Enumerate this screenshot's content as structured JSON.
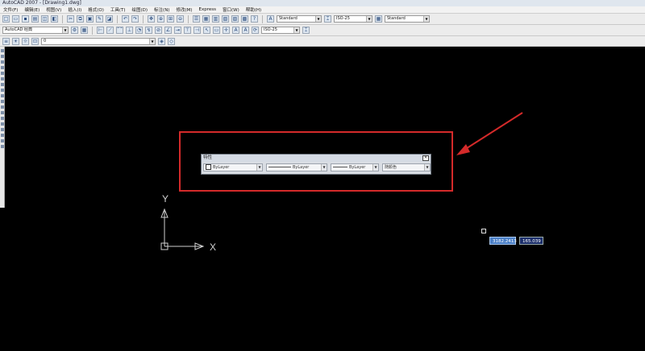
{
  "window": {
    "title": "AutoCAD 2007 - [Drawing1.dwg]"
  },
  "menubar": {
    "items": [
      "文件(F)",
      "编辑(E)",
      "视图(V)",
      "插入(I)",
      "格式(O)",
      "工具(T)",
      "绘图(D)",
      "标注(N)",
      "修改(M)",
      "Express",
      "窗口(W)",
      "帮助(H)"
    ]
  },
  "toolbar1": {
    "text_style": "Standard",
    "dim_style": "ISO-25",
    "table_style": "Standard"
  },
  "toolbar2": {
    "workspace": "AutoCAD 经典",
    "dim_style": "ISO-25"
  },
  "toolbar3": {
    "layer": "0"
  },
  "properties_panel": {
    "title": "特性",
    "close": "✕",
    "color": "ByLayer",
    "linetype": "ByLayer",
    "lineweight": "ByLayer",
    "plot_style": "随颜色"
  },
  "ucs": {
    "y_label": "Y",
    "x_label": "X"
  },
  "coordinates": {
    "x": "3182.2413",
    "y": "165.039"
  },
  "colors": {
    "highlight": "#d42a2a",
    "coord_x_bg": "#4a7fc7",
    "coord_y_bg": "#1c2f6b"
  }
}
